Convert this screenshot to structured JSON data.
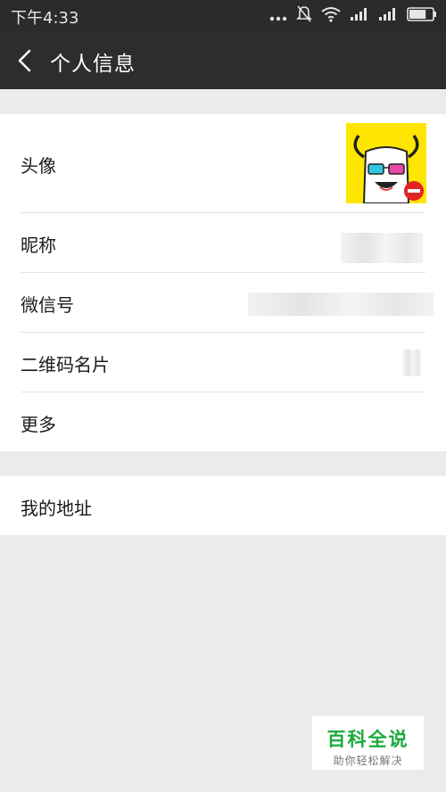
{
  "status_bar": {
    "time": "下午4:33",
    "battery_level": 0.7
  },
  "header": {
    "title": "个人信息"
  },
  "rows": [
    {
      "label": "头像"
    },
    {
      "label": "昵称"
    },
    {
      "label": "微信号"
    },
    {
      "label": "二维码名片"
    },
    {
      "label": "更多"
    }
  ],
  "section2": {
    "label": "我的地址"
  },
  "watermark": {
    "title": "百科全说",
    "subtitle": "助你轻松解决"
  },
  "colors": {
    "header_bg": "#2d2d2d",
    "avatar_bg": "#ffe600",
    "brand_green": "#1aab3a"
  }
}
